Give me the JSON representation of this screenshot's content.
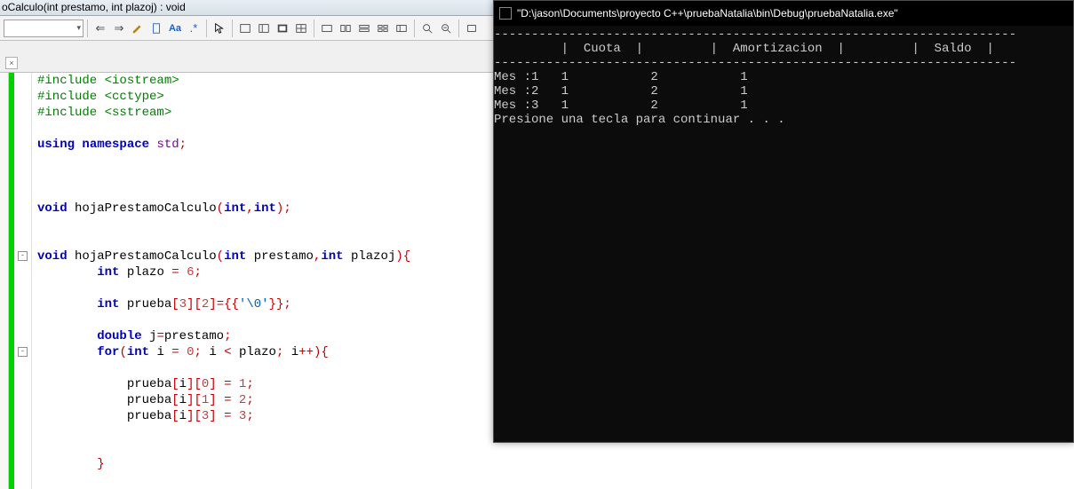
{
  "signature_bar": "oCalculo(int prestamo, int plazoj) : void",
  "toolbar": {
    "combo_value": ""
  },
  "tab": {
    "close_glyph": "×"
  },
  "fold": {
    "minus": "-"
  },
  "code_lines": [
    {
      "t": "pp",
      "s": "#include <iostream>"
    },
    {
      "t": "pp",
      "s": "#include <cctype>"
    },
    {
      "t": "pp",
      "s": "#include <sstream>"
    },
    {
      "t": "",
      "s": ""
    },
    {
      "t": "mix",
      "parts": [
        [
          "kw",
          "using"
        ],
        [
          "",
          ""
        ],
        [
          "kw",
          " namespace "
        ],
        [
          "type",
          "std"
        ],
        [
          "op",
          ";"
        ]
      ]
    },
    {
      "t": "",
      "s": ""
    },
    {
      "t": "",
      "s": ""
    },
    {
      "t": "",
      "s": ""
    },
    {
      "t": "mix",
      "parts": [
        [
          "kw",
          "void"
        ],
        [
          "",
          " "
        ],
        [
          "id",
          "hojaPrestamoCalculo"
        ],
        [
          "op",
          "("
        ],
        [
          "kw",
          "int"
        ],
        [
          "op",
          ","
        ],
        [
          "kw",
          "int"
        ],
        [
          "op",
          ")"
        ],
        [
          "op",
          ";"
        ]
      ]
    },
    {
      "t": "",
      "s": ""
    },
    {
      "t": "",
      "s": ""
    },
    {
      "t": "mix",
      "fold": true,
      "parts": [
        [
          "kw",
          "void"
        ],
        [
          "",
          " "
        ],
        [
          "id",
          "hojaPrestamoCalculo"
        ],
        [
          "op",
          "("
        ],
        [
          "kw",
          "int"
        ],
        [
          "",
          " "
        ],
        [
          "id",
          "prestamo"
        ],
        [
          "op",
          ","
        ],
        [
          "kw",
          "int"
        ],
        [
          "",
          " "
        ],
        [
          "id",
          "plazoj"
        ],
        [
          "op",
          ")"
        ],
        [
          "op",
          "{"
        ]
      ]
    },
    {
      "t": "mix",
      "indent": 2,
      "parts": [
        [
          "kw",
          "int"
        ],
        [
          "",
          " "
        ],
        [
          "id",
          "plazo"
        ],
        [
          "",
          " "
        ],
        [
          "op",
          "="
        ],
        [
          "",
          " "
        ],
        [
          "num",
          "6"
        ],
        [
          "op",
          ";"
        ]
      ]
    },
    {
      "t": "",
      "s": ""
    },
    {
      "t": "mix",
      "indent": 2,
      "parts": [
        [
          "kw",
          "int"
        ],
        [
          "",
          " "
        ],
        [
          "id",
          "prueba"
        ],
        [
          "op",
          "["
        ],
        [
          "num",
          "3"
        ],
        [
          "op",
          "]"
        ],
        [
          "op",
          "["
        ],
        [
          "num",
          "2"
        ],
        [
          "op",
          "]"
        ],
        [
          "op",
          "="
        ],
        [
          "op",
          "{"
        ],
        [
          "op",
          "{"
        ],
        [
          "str",
          "'\\0'"
        ],
        [
          "op",
          "}"
        ],
        [
          "op",
          "}"
        ],
        [
          "op",
          ";"
        ]
      ]
    },
    {
      "t": "",
      "s": ""
    },
    {
      "t": "mix",
      "indent": 2,
      "parts": [
        [
          "kw",
          "double"
        ],
        [
          "",
          " "
        ],
        [
          "id",
          "j"
        ],
        [
          "op",
          "="
        ],
        [
          "id",
          "prestamo"
        ],
        [
          "op",
          ";"
        ]
      ]
    },
    {
      "t": "mix",
      "fold": true,
      "indent": 2,
      "parts": [
        [
          "kw",
          "for"
        ],
        [
          "op",
          "("
        ],
        [
          "kw",
          "int"
        ],
        [
          "",
          " "
        ],
        [
          "id",
          "i"
        ],
        [
          "",
          " "
        ],
        [
          "op",
          "="
        ],
        [
          "",
          " "
        ],
        [
          "num",
          "0"
        ],
        [
          "op",
          ";"
        ],
        [
          "",
          " "
        ],
        [
          "id",
          "i"
        ],
        [
          "",
          " "
        ],
        [
          "op",
          "<"
        ],
        [
          "",
          " "
        ],
        [
          "id",
          "plazo"
        ],
        [
          "op",
          ";"
        ],
        [
          "",
          " "
        ],
        [
          "id",
          "i"
        ],
        [
          "op",
          "++"
        ],
        [
          "op",
          ")"
        ],
        [
          "op",
          "{"
        ]
      ]
    },
    {
      "t": "",
      "s": ""
    },
    {
      "t": "mix",
      "indent": 3,
      "parts": [
        [
          "id",
          "prueba"
        ],
        [
          "op",
          "["
        ],
        [
          "id",
          "i"
        ],
        [
          "op",
          "]"
        ],
        [
          "op",
          "["
        ],
        [
          "num",
          "0"
        ],
        [
          "op",
          "]"
        ],
        [
          "",
          " "
        ],
        [
          "op",
          "="
        ],
        [
          "",
          " "
        ],
        [
          "num",
          "1"
        ],
        [
          "op",
          ";"
        ]
      ]
    },
    {
      "t": "mix",
      "indent": 3,
      "parts": [
        [
          "id",
          "prueba"
        ],
        [
          "op",
          "["
        ],
        [
          "id",
          "i"
        ],
        [
          "op",
          "]"
        ],
        [
          "op",
          "["
        ],
        [
          "num",
          "1"
        ],
        [
          "op",
          "]"
        ],
        [
          "",
          " "
        ],
        [
          "op",
          "="
        ],
        [
          "",
          " "
        ],
        [
          "num",
          "2"
        ],
        [
          "op",
          ";"
        ]
      ]
    },
    {
      "t": "mix",
      "indent": 3,
      "parts": [
        [
          "id",
          "prueba"
        ],
        [
          "op",
          "["
        ],
        [
          "id",
          "i"
        ],
        [
          "op",
          "]"
        ],
        [
          "op",
          "["
        ],
        [
          "num",
          "3"
        ],
        [
          "op",
          "]"
        ],
        [
          "",
          " "
        ],
        [
          "op",
          "="
        ],
        [
          "",
          " "
        ],
        [
          "num",
          "3"
        ],
        [
          "op",
          ";"
        ]
      ]
    },
    {
      "t": "",
      "s": ""
    },
    {
      "t": "",
      "s": ""
    },
    {
      "t": "mix",
      "indent": 2,
      "parts": [
        [
          "op",
          "}"
        ]
      ]
    }
  ],
  "console": {
    "title": "\"D:\\jason\\Documents\\proyecto C++\\pruebaNatalia\\bin\\Debug\\pruebaNatalia.exe\"",
    "lines": [
      "----------------------------------------------------------------------",
      "         |  Cuota  |         |  Amortizacion  |         |  Saldo  |",
      "----------------------------------------------------------------------",
      "Mes :1   1           2           1",
      "Mes :2   1           2           1",
      "Mes :3   1           2           1",
      "Presione una tecla para continuar . . ."
    ]
  }
}
